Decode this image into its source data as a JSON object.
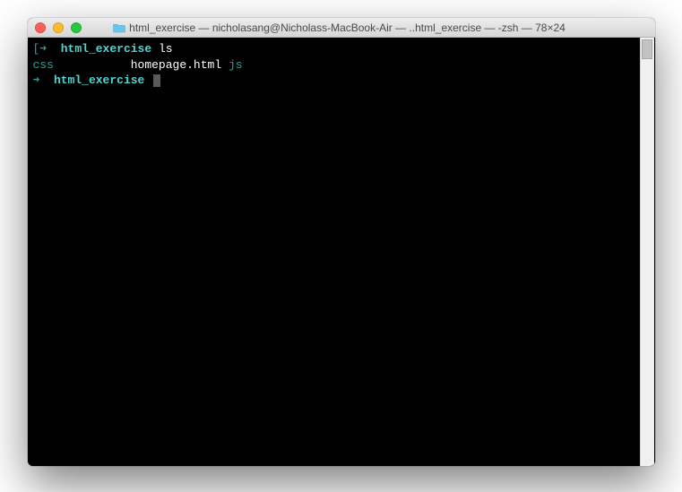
{
  "titlebar": {
    "title": "html_exercise — nicholasang@Nicholass-MacBook-Air — ..html_exercise — -zsh — 78×24"
  },
  "terminal": {
    "lines": [
      {
        "segments": [
          {
            "cls": "prompt-arrow",
            "text": "[➜  "
          },
          {
            "cls": "dir",
            "text": "html_exercise"
          },
          {
            "cls": "cmd",
            "text": " ls"
          }
        ]
      },
      {
        "segments": [
          {
            "cls": "ls-teal",
            "text": "css"
          },
          {
            "cls": "ls-white",
            "text": "           homepage.html "
          },
          {
            "cls": "ls-teal",
            "text": "js"
          }
        ]
      },
      {
        "segments": [
          {
            "cls": "prompt-arrow",
            "text": "➜  "
          },
          {
            "cls": "dir",
            "text": "html_exercise"
          },
          {
            "cls": "cmd",
            "text": " "
          }
        ],
        "cursor": true
      }
    ]
  }
}
